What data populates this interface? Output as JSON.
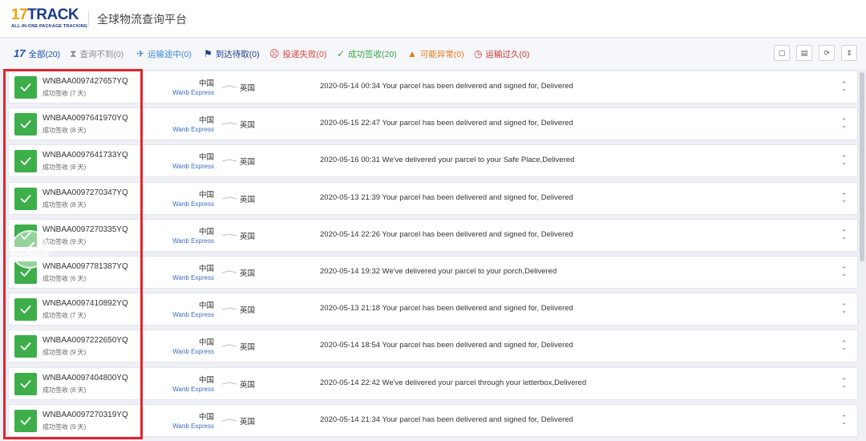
{
  "header": {
    "logo_main_17": "17",
    "logo_main_track": "TRACK",
    "logo_sub": "ALL-IN-ONE PACKAGE TRACKING",
    "platform_title": "全球物流查询平台"
  },
  "filters": {
    "all": "全部(20)",
    "not_found": "查询不到(0)",
    "in_transit": "运输途中(0)",
    "pickup": "到达待取(0)",
    "failed": "投递失败(0)",
    "delivered": "成功签收(20)",
    "exception": "可能异常(0)",
    "expired": "运输过久(0)"
  },
  "toolbar": {
    "btn1": "▢",
    "btn2": "▤",
    "btn3": "⟳",
    "btn4": "⇕"
  },
  "shipments": [
    {
      "tracking": "WNBAA0097427657YQ",
      "status": "成功签收 (7 天)",
      "origin": "中国",
      "carrier": "Wanb Express",
      "destination": "英国",
      "event": "2020-05-14 00:34  Your parcel has been delivered and signed for, Delivered"
    },
    {
      "tracking": "WNBAA0097641970YQ",
      "status": "成功签收 (8 天)",
      "origin": "中国",
      "carrier": "Wanb Express",
      "destination": "英国",
      "event": "2020-05-15 22:47  Your parcel has been delivered and signed for, Delivered"
    },
    {
      "tracking": "WNBAA0097641733YQ",
      "status": "成功签收 (8 天)",
      "origin": "中国",
      "carrier": "Wanb Express",
      "destination": "英国",
      "event": "2020-05-16 00:31  We've delivered your parcel to your Safe Place,Delivered"
    },
    {
      "tracking": "WNBAA0097270347YQ",
      "status": "成功签收 (8 天)",
      "origin": "中国",
      "carrier": "Wanb Express",
      "destination": "英国",
      "event": "2020-05-13 21:39  Your parcel has been delivered and signed for, Delivered"
    },
    {
      "tracking": "WNBAA0097270335YQ",
      "status": "成功签收 (9 天)",
      "origin": "中国",
      "carrier": "Wanb Express",
      "destination": "英国",
      "event": "2020-05-14 22:26  Your parcel has been delivered and signed for, Delivered"
    },
    {
      "tracking": "WNBAA0097781387YQ",
      "status": "成功签收 (6 天)",
      "origin": "中国",
      "carrier": "Wanb Express",
      "destination": "英国",
      "event": "2020-05-14 19:32  We've delivered your parcel to your porch,Delivered"
    },
    {
      "tracking": "WNBAA0097410892YQ",
      "status": "成功签收 (7 天)",
      "origin": "中国",
      "carrier": "Wanb Express",
      "destination": "英国",
      "event": "2020-05-13 21:18  Your parcel has been delivered and signed for, Delivered"
    },
    {
      "tracking": "WNBAA0097222650YQ",
      "status": "成功签收 (9 天)",
      "origin": "中国",
      "carrier": "Wanb Express",
      "destination": "英国",
      "event": "2020-05-14 18:54  Your parcel has been delivered and signed for, Delivered"
    },
    {
      "tracking": "WNBAA0097404800YQ",
      "status": "成功签收 (8 天)",
      "origin": "中国",
      "carrier": "Wanb Express",
      "destination": "英国",
      "event": "2020-05-14 22:42  We've delivered your parcel through your letterbox,Delivered"
    },
    {
      "tracking": "WNBAA0097270319YQ",
      "status": "成功签收 (9 天)",
      "origin": "中国",
      "carrier": "Wanb Express",
      "destination": "英国",
      "event": "2020-05-14 21:34  Your parcel has been delivered and signed for, Delivered"
    }
  ],
  "icons": {
    "expand": "⌃⌄"
  },
  "colors": {
    "delivered_green": "#3dae4a",
    "brand_blue": "#1b3a8a",
    "brand_orange": "#f4a100",
    "highlight_red": "#e8232a"
  }
}
